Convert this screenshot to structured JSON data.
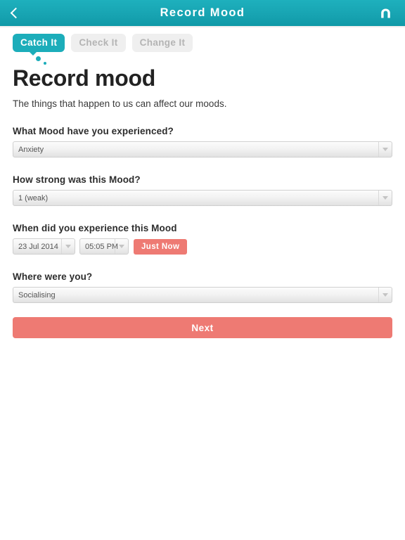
{
  "header": {
    "title": "Record Mood",
    "back_icon": "chevron-left-icon",
    "home_icon": "home-icon",
    "background_color": "#17a3b1"
  },
  "tabs": [
    {
      "label": "Catch It",
      "active": true
    },
    {
      "label": "Check It",
      "active": false
    },
    {
      "label": "Change It",
      "active": false
    }
  ],
  "main": {
    "title": "Record mood",
    "subtitle": "The things that happen to us can affect our moods.",
    "fields": [
      {
        "label": "What Mood have you experienced?",
        "value": "Anxiety",
        "control": "select"
      },
      {
        "label": "How strong was this Mood?",
        "value": "1 (weak)",
        "control": "select"
      },
      {
        "label": "When did you experience this Mood",
        "control": "datetime",
        "date_value": "23 Jul 2014",
        "time_value": "05:05 PM",
        "just_now_label": "Just Now"
      },
      {
        "label": "Where were you?",
        "value": "Socialising",
        "control": "select"
      }
    ],
    "next_label": "Next"
  },
  "colors": {
    "accent_teal": "#1cadba",
    "accent_salmon": "#ee7a73",
    "tab_inactive_bg": "#efefef",
    "tab_inactive_text": "#b4b4b4"
  }
}
